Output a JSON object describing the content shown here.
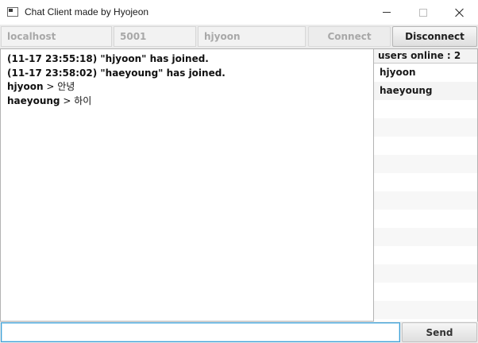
{
  "window": {
    "title": "Chat Client made by Hyojeon"
  },
  "connection": {
    "host_value": "localhost",
    "port_value": "5001",
    "username_value": "hjyoon",
    "connect_label": "Connect",
    "disconnect_label": "Disconnect"
  },
  "chat": {
    "system_messages": [
      "(11-17 23:55:18) \"hjyoon\" has joined.",
      "(11-17 23:58:02) \"haeyoung\" has joined."
    ],
    "messages": [
      {
        "sender": "hjyoon",
        "separator": " > ",
        "text": "안녕"
      },
      {
        "sender": "haeyoung",
        "separator": " > ",
        "text": "하이"
      }
    ]
  },
  "users": {
    "header": "users online : 2",
    "list": [
      "hjyoon",
      "haeyoung"
    ]
  },
  "composer": {
    "input_value": "",
    "send_label": "Send"
  },
  "colors": {
    "input_focus_border": "#3c9fd6",
    "disabled_text": "#a8a8a8"
  }
}
